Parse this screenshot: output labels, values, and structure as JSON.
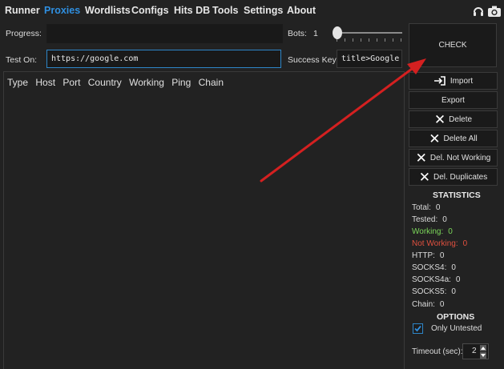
{
  "menu": {
    "tabs": [
      "Runner",
      "Proxies",
      "Wordlists",
      "Configs",
      "Hits DB",
      "Tools",
      "Settings",
      "About"
    ],
    "active": "Proxies",
    "icons": [
      "headset-icon",
      "camera-icon"
    ]
  },
  "form": {
    "progress_label": "Progress:",
    "bots_label": "Bots:",
    "bots_value": "1",
    "test_on_label": "Test On:",
    "test_on_value": "https://google.com",
    "success_key_label": "Success Key:",
    "success_key_value": "title>Google"
  },
  "check_label": "CHECK",
  "list": {
    "columns": [
      "Type",
      "Host",
      "Port",
      "Country",
      "Working",
      "Ping",
      "Chain"
    ]
  },
  "buttons": {
    "import": "Import",
    "export": "Export",
    "delete": "Delete",
    "delete_all": "Delete All",
    "del_not_working": "Del. Not Working",
    "del_duplicates": "Del. Duplicates"
  },
  "statistics": {
    "title": "STATISTICS",
    "total_label": "Total:",
    "total": "0",
    "tested_label": "Tested:",
    "tested": "0",
    "working_label": "Working:",
    "working": "0",
    "not_working_label": "Not Working:",
    "not_working": "0",
    "http_label": "HTTP:",
    "http": "0",
    "socks4_label": "SOCKS4:",
    "socks4": "0",
    "socks4a_label": "SOCKS4a:",
    "socks4a": "0",
    "socks5_label": "SOCKS5:",
    "socks5": "0",
    "chain_label": "Chain:",
    "chain": "0"
  },
  "options": {
    "title": "OPTIONS",
    "only_untested_label": "Only Untested",
    "only_untested_checked": true,
    "timeout_label": "Timeout (sec):",
    "timeout_value": "2"
  },
  "colors": {
    "accent": "#2f8fe0",
    "working": "#7bd65a",
    "not_working": "#e0503f",
    "annotation_arrow": "#d42020"
  }
}
